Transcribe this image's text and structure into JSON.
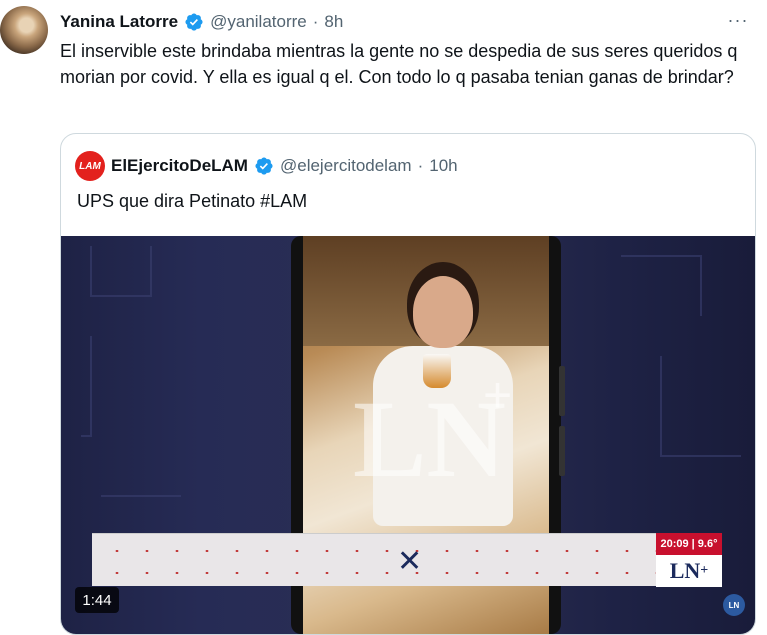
{
  "tweet": {
    "author_name": "Yanina Latorre",
    "handle": "@yanilatorre",
    "separator": "·",
    "time": "8h",
    "more_icon": "···",
    "text": "El inservible este brindaba mientras la gente no se despedia de sus seres queridos q morian por covid. Y ella es igual q el. Con todo lo q pasaba tenian ganas de brindar?"
  },
  "quote": {
    "avatar_text": "LAM",
    "author_name": "ElEjercitoDeLAM",
    "handle": "@elejercitodelam",
    "separator": "·",
    "time": "10h",
    "text": "UPS que dira Petinato #LAM"
  },
  "media": {
    "duration": "1:44",
    "broadcast_time": "20:09 | 9.6°",
    "logo_text": "LN",
    "logo_plus": "+",
    "round_logo": "LN",
    "ticker_icon": "x-icon"
  },
  "colors": {
    "verified": "#1d9bf0",
    "lam_red": "#e3211d",
    "ln_red": "#c8102e",
    "ln_navy": "#1b2a5c"
  }
}
